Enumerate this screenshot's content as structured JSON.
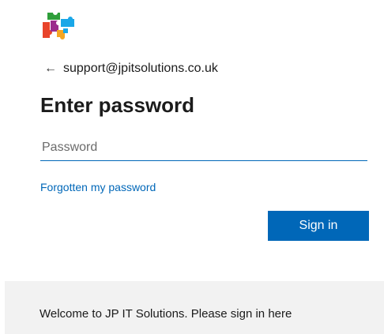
{
  "logo": {
    "icon": "jigsaw-puzzle-logo",
    "colors": [
      "#2e9e3a",
      "#e8442b",
      "#1aa7e8",
      "#f5a623",
      "#9b2c8c"
    ]
  },
  "identity": {
    "back_icon": "←",
    "email": "support@jpitsolutions.co.uk"
  },
  "title": "Enter password",
  "password": {
    "placeholder": "Password",
    "value": ""
  },
  "forgot_link": "Forgotten my password",
  "signin_button": "Sign in",
  "footer": {
    "message": "Welcome to JP IT Solutions. Please sign in here"
  },
  "colors": {
    "accent": "#0067b8",
    "footer_bg": "#f2f2f2"
  }
}
